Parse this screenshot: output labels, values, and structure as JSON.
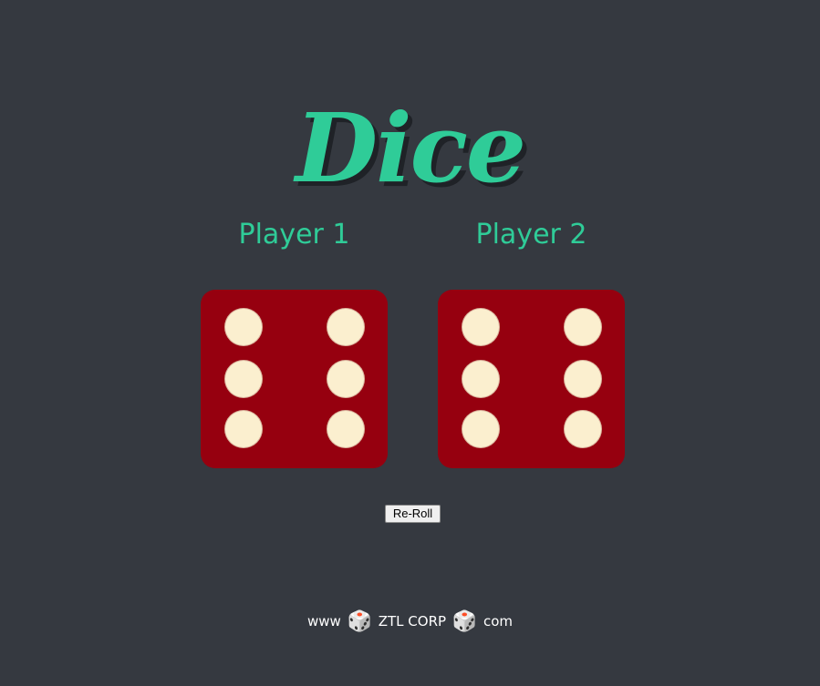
{
  "header": {
    "title": "Dice"
  },
  "players": [
    {
      "label": "Player 1",
      "die_value": 6
    },
    {
      "label": "Player 2",
      "die_value": 6
    }
  ],
  "controls": {
    "reroll_label": "Re-Roll"
  },
  "footer": {
    "prefix": "www",
    "brand": "ZTL CORP",
    "suffix": "com",
    "separator_icon": "dice-icon"
  },
  "colors": {
    "background": "#353940",
    "accent": "#2fcc98",
    "die_face": "#96000f",
    "pip": "#fbefcf"
  }
}
